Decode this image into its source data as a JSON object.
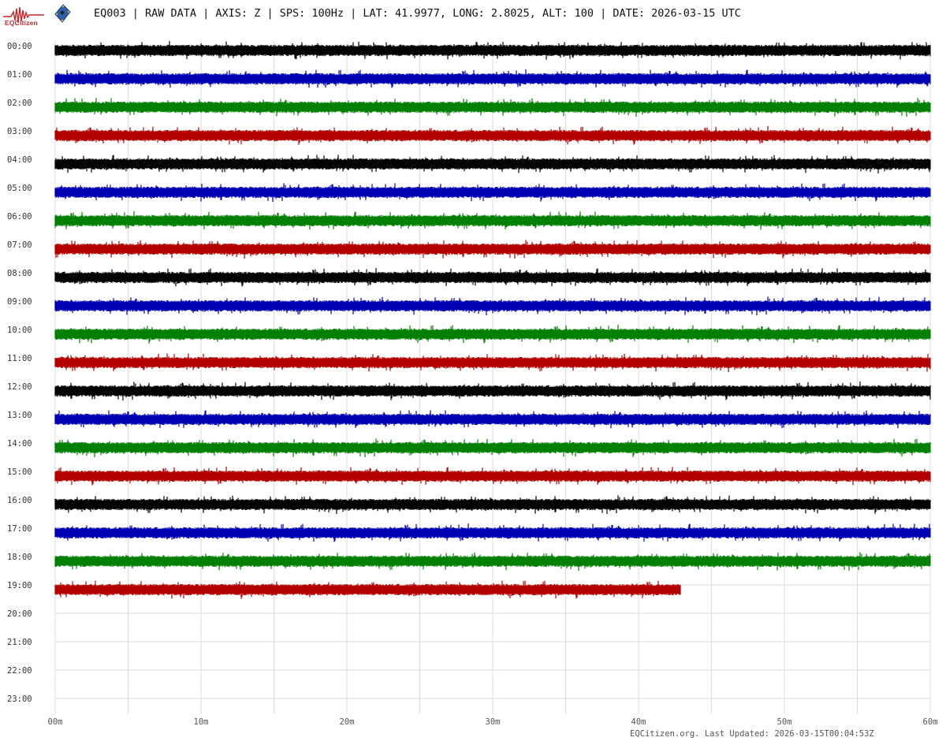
{
  "logo": {
    "text": "EQCitizen"
  },
  "header": {
    "title": "EQ003 | RAW DATA | AXIS: Z | SPS: 100Hz | LAT: 41.9977, LONG: 2.8025, ALT: 100 | DATE: 2026-03-15 UTC"
  },
  "chart_data": {
    "type": "line",
    "title": "EQ003 | RAW DATA | AXIS: Z | SPS: 100Hz | LAT: 41.9977, LONG: 2.8025, ALT: 100 | DATE: 2026-03-15 UTC",
    "rows": [
      "00:00",
      "01:00",
      "02:00",
      "03:00",
      "04:00",
      "05:00",
      "06:00",
      "07:00",
      "08:00",
      "09:00",
      "10:00",
      "11:00",
      "12:00",
      "13:00",
      "14:00",
      "15:00",
      "16:00",
      "17:00",
      "18:00",
      "19:00",
      "20:00",
      "21:00",
      "22:00",
      "23:00"
    ],
    "x_ticks": [
      "00m",
      "10m",
      "20m",
      "30m",
      "40m",
      "50m",
      "60m"
    ],
    "xlim": [
      0,
      60
    ],
    "grid": true,
    "series_colors": [
      "#000000",
      "#0000b4",
      "#008000",
      "#b40000"
    ],
    "data_end_minutes": [
      60,
      60,
      60,
      60,
      60,
      60,
      60,
      60,
      60,
      60,
      60,
      60,
      60,
      60,
      60,
      60,
      60,
      60,
      60,
      42.9,
      0,
      0,
      0,
      0
    ]
  },
  "footer": {
    "text": "EQCitizen.org. Last Updated: 2026-03-15T00:04:53Z"
  }
}
